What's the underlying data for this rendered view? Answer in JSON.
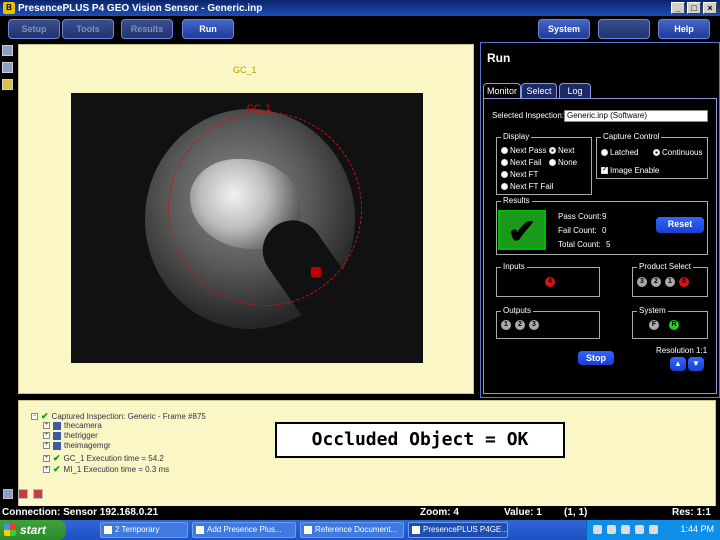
{
  "window": {
    "title": "PresencePLUS P4 GEO Vision Sensor - Generic.inp"
  },
  "menu": {
    "items": [
      "Setup",
      "Tools",
      "Results",
      "Run",
      "System",
      "Help"
    ],
    "system": "System",
    "help": "Help",
    "active": "Run"
  },
  "viewer": {
    "label_top": "GC_1",
    "label_ring": "GC_1"
  },
  "run": {
    "title": "Run",
    "tabs": [
      "Monitor",
      "Select",
      "Log"
    ],
    "selected_inspection_label": "Selected Inspection:",
    "selected_inspection_value": "Generic.inp (Software)",
    "display": {
      "title": "Display",
      "options": [
        "Next Pass",
        "Next",
        "Next Fail",
        "None",
        "Next FT",
        "Next FT Fail"
      ]
    },
    "capture": {
      "title": "Capture Control",
      "latched": "Latched",
      "continuous": "Continuous",
      "image_enable": "Image Enable"
    },
    "results": {
      "title": "Results",
      "pass_symbol": "✔",
      "pass_label": "Pass Count:",
      "pass_value": "9",
      "fail_label": "Fail Count:",
      "fail_value": "0",
      "total_label": "Total Count:",
      "total_value": "5",
      "reset": "Reset"
    },
    "inputs": {
      "title": "Inputs",
      "dots": [
        "4"
      ]
    },
    "product_select": {
      "title": "Product Select",
      "dots": [
        "3",
        "2",
        "1",
        "0"
      ]
    },
    "outputs": {
      "title": "Outputs",
      "dots": [
        "1",
        "2",
        "3"
      ]
    },
    "system": {
      "title": "System",
      "dots": [
        "F",
        "R"
      ]
    },
    "resolution": "Resolution 1:1",
    "stop": "Stop"
  },
  "tree": {
    "rows": [
      "Captured Inspection: Generic - Frame #875",
      "thecamera",
      "thetrigger",
      "theimagemgr",
      "GC_1 Execution time = 54.2",
      "MI_1 Execution time = 0.3 ms"
    ]
  },
  "overlay_text": "Occluded Object = OK",
  "status": {
    "connection": "Connection: Sensor 192.168.0.21",
    "zoom": "Zoom: 4",
    "value": "Value: 1",
    "coords": "(1, 1)",
    "res": "Res: 1:1"
  },
  "taskbar": {
    "start": "start",
    "tasks": [
      "2 Temporary",
      "Add Presence Plus...",
      "Reference Document...",
      "PresencePLUS P4GE..."
    ],
    "clock": "1:44 PM"
  }
}
